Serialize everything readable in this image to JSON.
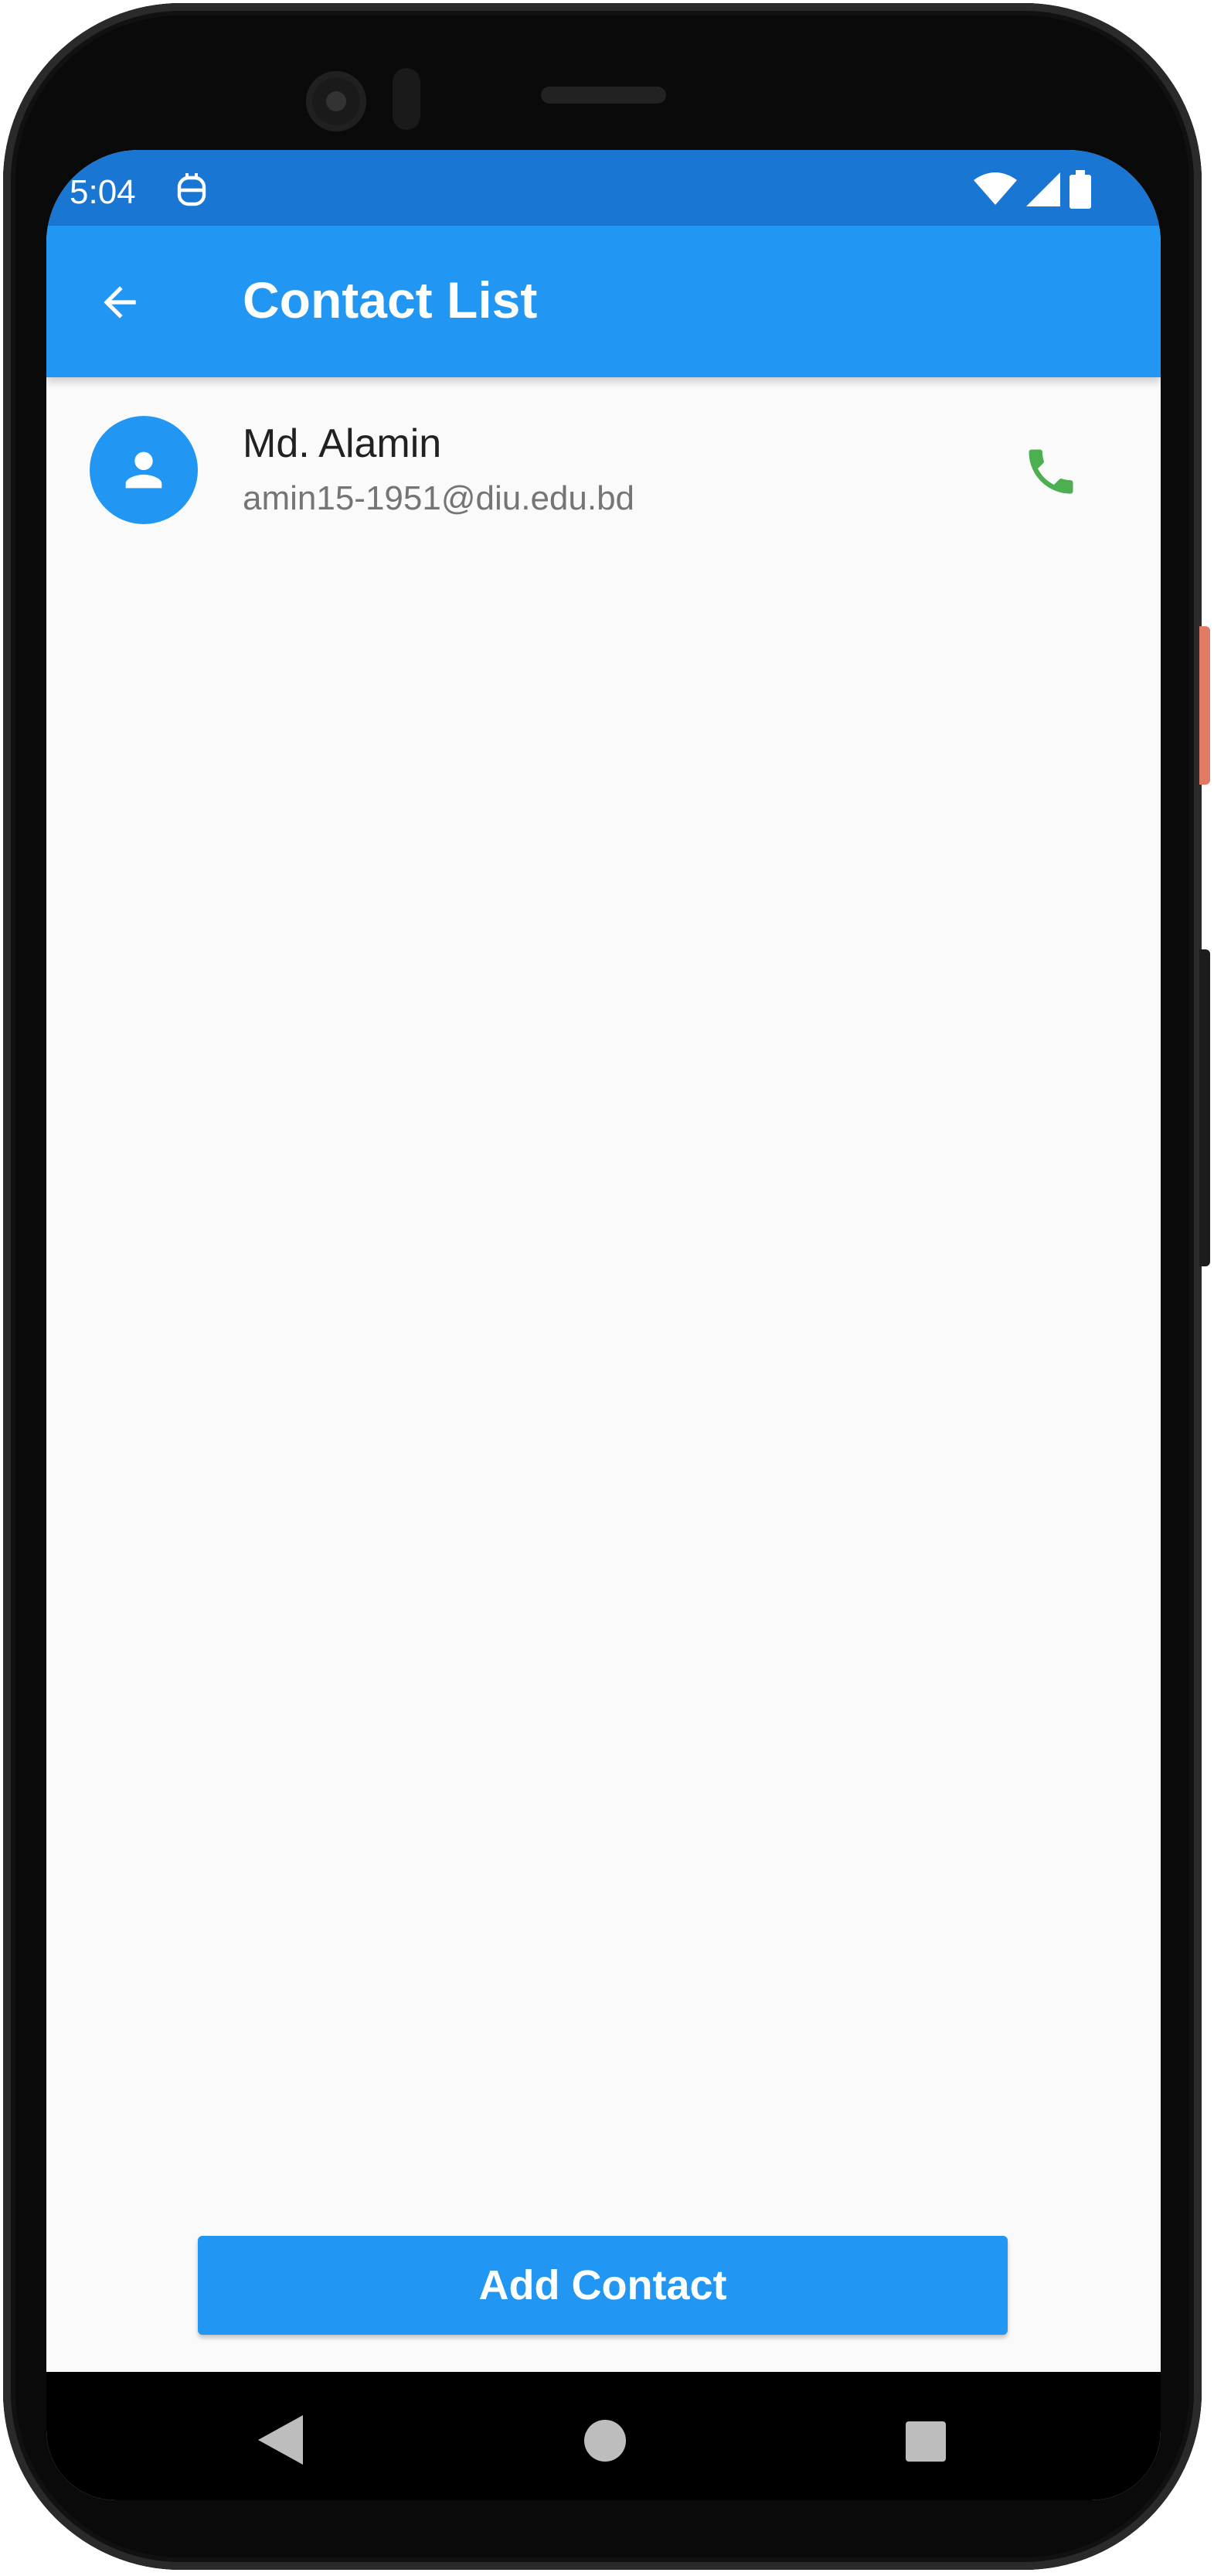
{
  "status_bar": {
    "time": "5:04",
    "icons": [
      "robot-icon",
      "wifi-icon",
      "signal-icon",
      "battery-icon"
    ]
  },
  "app_bar": {
    "title": "Contact List",
    "back_icon": "arrow-back-icon",
    "color": "#2196f3"
  },
  "contacts": [
    {
      "name": "Md. Alamin",
      "email": "amin15-1951@diu.edu.bd",
      "avatar_icon": "person-icon",
      "action_icon": "phone-icon"
    }
  ],
  "add_button": {
    "label": "Add Contact"
  },
  "nav_bar": {
    "icons": [
      "nav-back-icon",
      "nav-home-icon",
      "nav-recents-icon"
    ]
  },
  "colors": {
    "primary": "#2196f3",
    "status_bar": "#1976d2",
    "phone_icon": "#4caf50",
    "background": "#fafafa"
  }
}
